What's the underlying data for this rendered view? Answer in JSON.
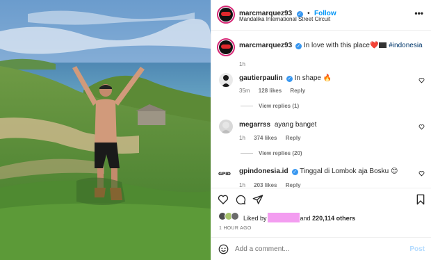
{
  "post": {
    "author": "marcmarquez93",
    "separator": "•",
    "follow_label": "Follow",
    "location": "Mandalika International Street Circuit",
    "more_icon": "more-horizontal-icon"
  },
  "caption": {
    "username": "marcmarquez93",
    "text": "In love with this place",
    "emoji": "❤️",
    "hashtag": "#indonesia",
    "time": "1h"
  },
  "comments": [
    {
      "username": "gautierpaulin",
      "verified": true,
      "text": "In shape 🔥",
      "time": "35m",
      "likes": "128 likes",
      "reply": "Reply",
      "view_replies": "View replies (1)"
    },
    {
      "username": "megarrss",
      "verified": false,
      "text": "ayang banget",
      "time": "1h",
      "likes": "374 likes",
      "reply": "Reply",
      "view_replies": "View replies (20)"
    },
    {
      "username": "gpindonesia.id",
      "verified": true,
      "text": "Tinggal di Lombok aja Bosku 😊",
      "time": "1h",
      "likes": "203 likes",
      "reply": "Reply"
    }
  ],
  "actions": {
    "icons": [
      "heart-icon",
      "comment-icon",
      "share-icon",
      "bookmark-icon"
    ],
    "liked_by_prefix": "Liked by",
    "liked_by_suffix": "and",
    "likes_count": "220,114 others",
    "time_ago": "1 HOUR AGO"
  },
  "composer": {
    "placeholder": "Add a comment...",
    "post_label": "Post"
  },
  "colors": {
    "link_blue": "#0095f6",
    "verified_blue": "#3897f0",
    "muted": "#737373",
    "redaction": "#f39df0",
    "post_disabled": "#b3dbff"
  }
}
